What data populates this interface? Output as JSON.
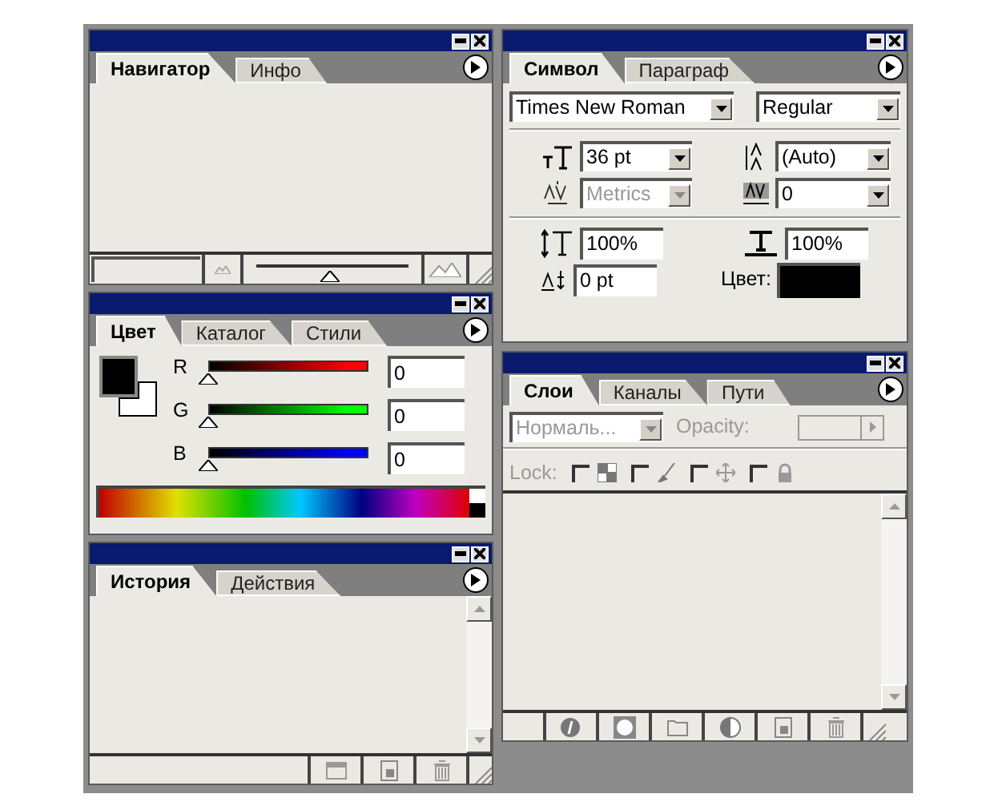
{
  "navigator": {
    "tabs": [
      {
        "label": "Навигатор",
        "selected": true
      },
      {
        "label": "Инфо",
        "selected": false
      }
    ],
    "zoom_slider": {
      "level": 0.48
    }
  },
  "color": {
    "tabs": [
      {
        "label": "Цвет",
        "selected": true
      },
      {
        "label": "Каталог",
        "selected": false
      },
      {
        "label": "Стили",
        "selected": false
      }
    ],
    "channels": [
      {
        "label": "R",
        "value": "0",
        "level": 0,
        "color": "#ff0000"
      },
      {
        "label": "G",
        "value": "0",
        "level": 0,
        "color": "#00ff00"
      },
      {
        "label": "B",
        "value": "0",
        "level": 0,
        "color": "#0000ff"
      }
    ]
  },
  "history": {
    "tabs": [
      {
        "label": "История",
        "selected": true
      },
      {
        "label": "Действия",
        "selected": false
      }
    ]
  },
  "character": {
    "tabs": [
      {
        "label": "Символ",
        "selected": true
      },
      {
        "label": "Параграф",
        "selected": false
      }
    ],
    "font_family": "Times New Roman",
    "font_style": "Regular",
    "size": "36 pt",
    "leading": "(Auto)",
    "kerning": {
      "value": "Metrics",
      "disabled": true
    },
    "tracking": "0",
    "vertical_scale": "100%",
    "horizontal_scale": "100%",
    "baseline_shift": "0 pt",
    "color_label": "Цвет:"
  },
  "layers": {
    "tabs": [
      {
        "label": "Слои",
        "selected": true
      },
      {
        "label": "Каналы",
        "selected": false
      },
      {
        "label": "Пути",
        "selected": false
      }
    ],
    "blend_mode": {
      "value": "Нормаль...",
      "disabled": true
    },
    "opacity_label": "Opacity:",
    "lock_label": "Lock:",
    "locks": [
      {
        "checked": false
      },
      {
        "checked": false
      },
      {
        "checked": false
      },
      {
        "checked": false
      }
    ]
  }
}
